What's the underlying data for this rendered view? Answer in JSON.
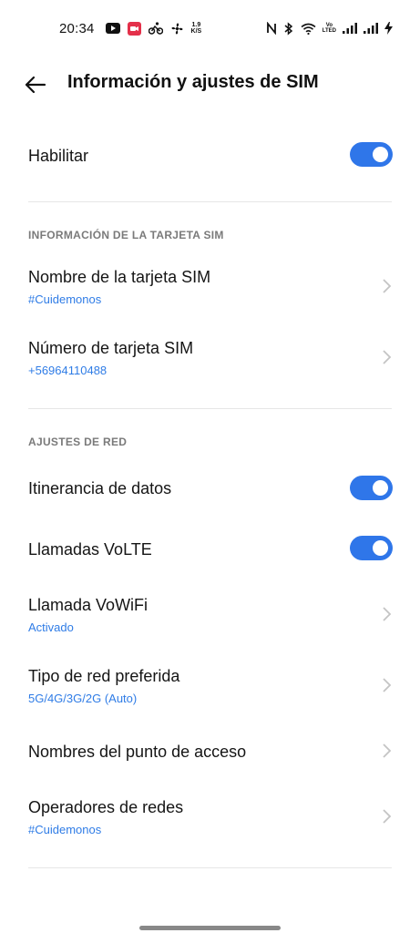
{
  "status_bar": {
    "time": "20:34",
    "speed_value": "1.9",
    "speed_unit": "K/S",
    "volte_top": "Vo",
    "volte_bottom": "LTED"
  },
  "header": {
    "title": "Información y ajustes de SIM"
  },
  "habilitar": {
    "label": "Habilitar",
    "on": true
  },
  "sim_info": {
    "section_label": "INFORMACIÓN DE LA TARJETA SIM",
    "name": {
      "title": "Nombre de la tarjeta SIM",
      "value": "#Cuidemonos"
    },
    "number": {
      "title": "Número de tarjeta SIM",
      "value": "+56964110488"
    }
  },
  "network": {
    "section_label": "AJUSTES DE RED",
    "roaming": {
      "label": "Itinerancia de datos",
      "on": true
    },
    "volte": {
      "label": "Llamadas VoLTE",
      "on": true
    },
    "vowifi": {
      "title": "Llamada VoWiFi",
      "value": "Activado"
    },
    "preferred": {
      "title": "Tipo de red preferida",
      "value": "5G/4G/3G/2G (Auto)"
    },
    "apn": {
      "title": "Nombres del punto de acceso"
    },
    "operators": {
      "title": "Operadores de redes",
      "value": "#Cuidemonos"
    }
  },
  "colors": {
    "accent": "#2f76e9",
    "link": "#2f7ce6",
    "section_text": "#7a7a7a",
    "divider": "#e6e6e6"
  }
}
